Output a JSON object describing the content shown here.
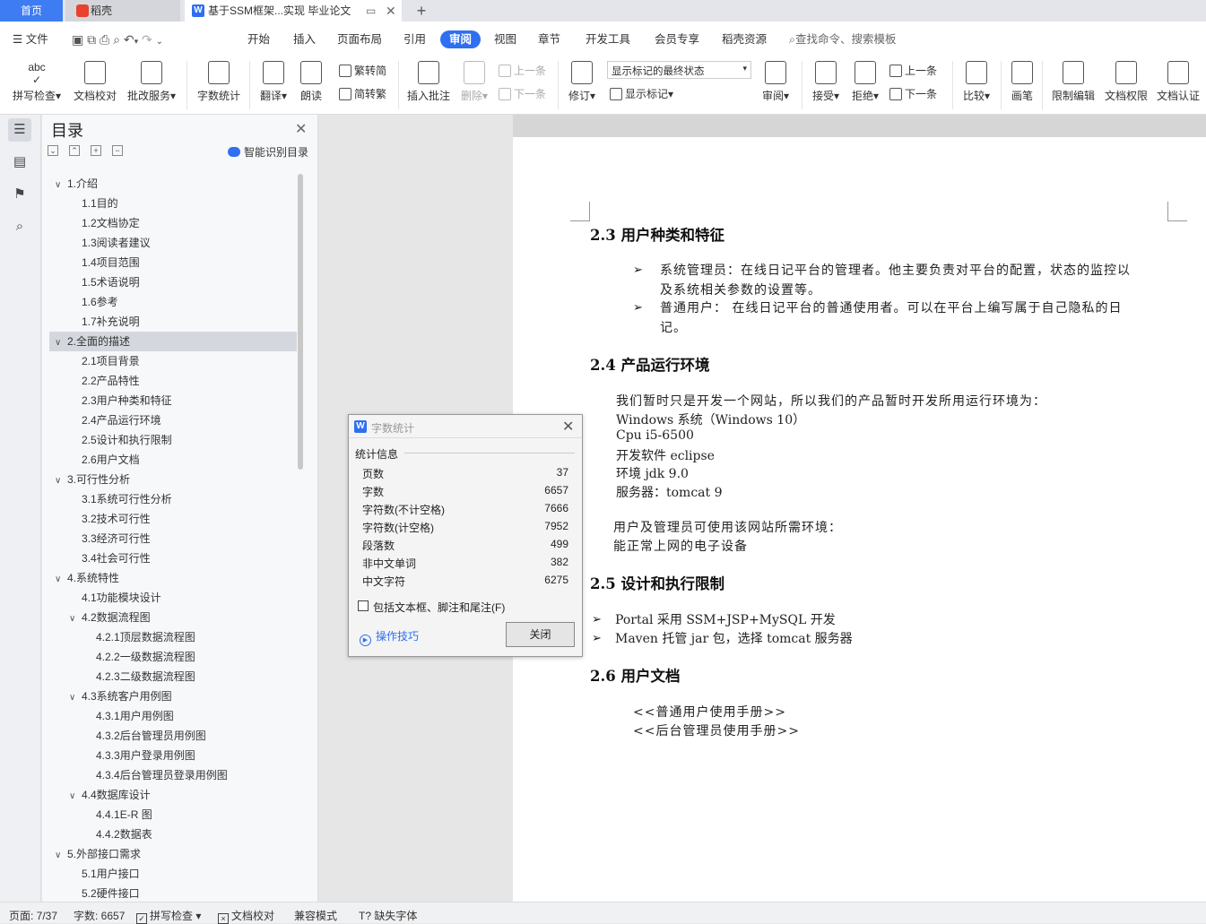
{
  "tabs": {
    "home": "首页",
    "daoke": "稻壳",
    "doc": "基于SSM框架...实现 毕业论文",
    "new": "+"
  },
  "menu": {
    "file": "文件",
    "items": [
      "开始",
      "插入",
      "页面布局",
      "引用",
      "审阅",
      "视图",
      "章节",
      "开发工具",
      "会员专享",
      "稻壳资源"
    ],
    "search": "查找命令、搜索模板"
  },
  "ribbon": {
    "spell": "拼写检查",
    "proof": "文档校对",
    "correct": "批改服务",
    "count": "字数统计",
    "translate": "翻译",
    "read": "朗读",
    "t2s": "繁转简",
    "s2t": "简转繁",
    "insert_comment": "插入批注",
    "delete": "删除",
    "prev": "上一条",
    "next": "下一条",
    "revise": "修订",
    "markup_state": "显示标记的最终状态",
    "show_markup": "显示标记",
    "review": "审阅",
    "accept": "接受",
    "reject": "拒绝",
    "prev2": "上一条",
    "next2": "下一条",
    "compare": "比较",
    "pen": "画笔",
    "restrict": "限制编辑",
    "perm": "文档权限",
    "cert": "文档认证"
  },
  "toc": {
    "title": "目录",
    "smart": "智能识别目录",
    "items": [
      {
        "t": "1.介绍",
        "lv": 1,
        "car": "v"
      },
      {
        "t": "1.1目的",
        "lv": 2
      },
      {
        "t": "1.2文档协定",
        "lv": 2
      },
      {
        "t": "1.3阅读者建议",
        "lv": 2
      },
      {
        "t": "1.4项目范围",
        "lv": 2
      },
      {
        "t": "1.5术语说明",
        "lv": 2
      },
      {
        "t": "1.6参考",
        "lv": 2
      },
      {
        "t": "1.7补充说明",
        "lv": 2
      },
      {
        "t": "2.全面的描述",
        "lv": 1,
        "car": "v",
        "sel": true
      },
      {
        "t": "2.1项目背景",
        "lv": 2
      },
      {
        "t": "2.2产品特性",
        "lv": 2
      },
      {
        "t": "2.3用户种类和特征",
        "lv": 2
      },
      {
        "t": "2.4产品运行环境",
        "lv": 2
      },
      {
        "t": "2.5设计和执行限制",
        "lv": 2
      },
      {
        "t": "2.6用户文档",
        "lv": 2
      },
      {
        "t": "3.可行性分析",
        "lv": 1,
        "car": "v"
      },
      {
        "t": "3.1系统可行性分析",
        "lv": 2
      },
      {
        "t": "3.2技术可行性",
        "lv": 2
      },
      {
        "t": "3.3经济可行性",
        "lv": 2
      },
      {
        "t": "3.4社会可行性",
        "lv": 2
      },
      {
        "t": "4.系统特性",
        "lv": 1,
        "car": "v"
      },
      {
        "t": "4.1功能模块设计",
        "lv": 2
      },
      {
        "t": "4.2数据流程图",
        "lv": 2,
        "car": "v"
      },
      {
        "t": "4.2.1顶层数据流程图",
        "lv": 3
      },
      {
        "t": "4.2.2一级数据流程图",
        "lv": 3
      },
      {
        "t": "4.2.3二级数据流程图",
        "lv": 3
      },
      {
        "t": "4.3系统客户用例图",
        "lv": 2,
        "car": "v"
      },
      {
        "t": "4.3.1用户用例图",
        "lv": 3
      },
      {
        "t": "4.3.2后台管理员用例图",
        "lv": 3
      },
      {
        "t": "4.3.3用户登录用例图",
        "lv": 3
      },
      {
        "t": "4.3.4后台管理员登录用例图",
        "lv": 3
      },
      {
        "t": "4.4数据库设计",
        "lv": 2,
        "car": "v"
      },
      {
        "t": "4.4.1E-R 图",
        "lv": 3
      },
      {
        "t": "4.4.2数据表",
        "lv": 3
      },
      {
        "t": "5.外部接口需求",
        "lv": 1,
        "car": "v"
      },
      {
        "t": "5.1用户接口",
        "lv": 2
      },
      {
        "t": "5.2硬件接口",
        "lv": 2
      }
    ]
  },
  "doc": {
    "s23": "2.3  用户种类和特征",
    "s23_b1a": "系统管理员：在线日记平台的管理者。他主要负责对平台的配置，状态的监控以",
    "s23_b1b": "及系统相关参数的设置等。",
    "s23_b2a": "普通用户： 在线日记平台的普通使用者。可以在平台上编写属于自己隐私的日",
    "s23_b2b": "记。",
    "s24": "2.4  产品运行环境",
    "s24_l1": "我们暂时只是开发一个网站，所以我们的产品暂时开发所用运行环境为：",
    "s24_l2": "Windows 系统（Windows 10）",
    "s24_l3": "Cpu i5-6500",
    "s24_l4": "开发软件 eclipse",
    "s24_l5": "环境 jdk 9.0",
    "s24_l6": "服务器：tomcat 9",
    "s24_l7": "用户及管理员可使用该网站所需环境：",
    "s24_l8": "能正常上网的电子设备",
    "s25": "2.5  设计和执行限制",
    "s25_b1": "Portal 采用 SSM+JSP+MySQL 开发",
    "s25_b2": "Maven 托管 jar 包，选择 tomcat 服务器",
    "s26": "2.6  用户文档",
    "s26_l1": "<<普通用户使用手册>>",
    "s26_l2": "<<后台管理员使用手册>>",
    "bullet": "➢"
  },
  "dialog": {
    "title": "字数统计",
    "group": "统计信息",
    "rows": [
      {
        "k": "页数",
        "v": "37"
      },
      {
        "k": "字数",
        "v": "6657"
      },
      {
        "k": "字符数(不计空格)",
        "v": "7666"
      },
      {
        "k": "字符数(计空格)",
        "v": "7952"
      },
      {
        "k": "段落数",
        "v": "499"
      },
      {
        "k": "非中文单词",
        "v": "382"
      },
      {
        "k": "中文字符",
        "v": "6275"
      }
    ],
    "checkbox": "包括文本框、脚注和尾注(F)",
    "tips": "操作技巧",
    "close": "关闭"
  },
  "status": {
    "page": "页面: 7/37",
    "words": "字数: 6657",
    "spell": "拼写检查",
    "proof": "文档校对",
    "compat": "兼容模式",
    "font": "缺失字体"
  },
  "colors": {
    "accent": "#2f6ff0",
    "selected": "#d4d8de"
  }
}
